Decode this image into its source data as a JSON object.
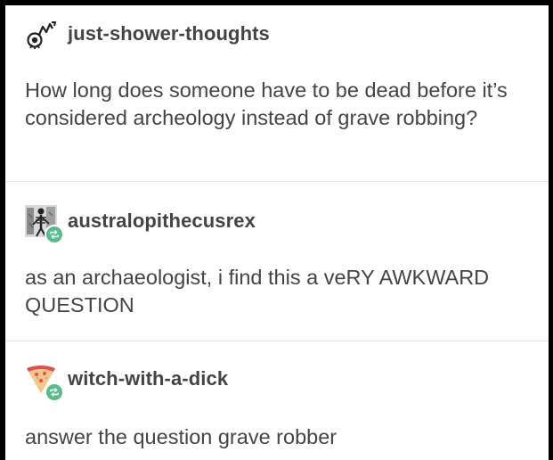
{
  "posts": [
    {
      "username": "just-shower-thoughts",
      "avatar_icon": "showerhead-icon",
      "reblog": false,
      "text": "How long does someone have to be dead before it’s considered archeology instead of grave robbing?"
    },
    {
      "username": "australopithecusrex",
      "avatar_icon": "skeleton-photo-icon",
      "reblog": true,
      "text": "as an archaeologist, i find this a veRY AWKWARD QUESTION"
    },
    {
      "username": "witch-with-a-dick",
      "avatar_icon": "pizza-slice-icon",
      "reblog": true,
      "text": "answer the question grave robber"
    }
  ],
  "colors": {
    "text": "#444444",
    "background": "#ffffff",
    "frame": "#000000",
    "divider": "#e6e6e6",
    "reblog_badge": "#56bc8a"
  }
}
